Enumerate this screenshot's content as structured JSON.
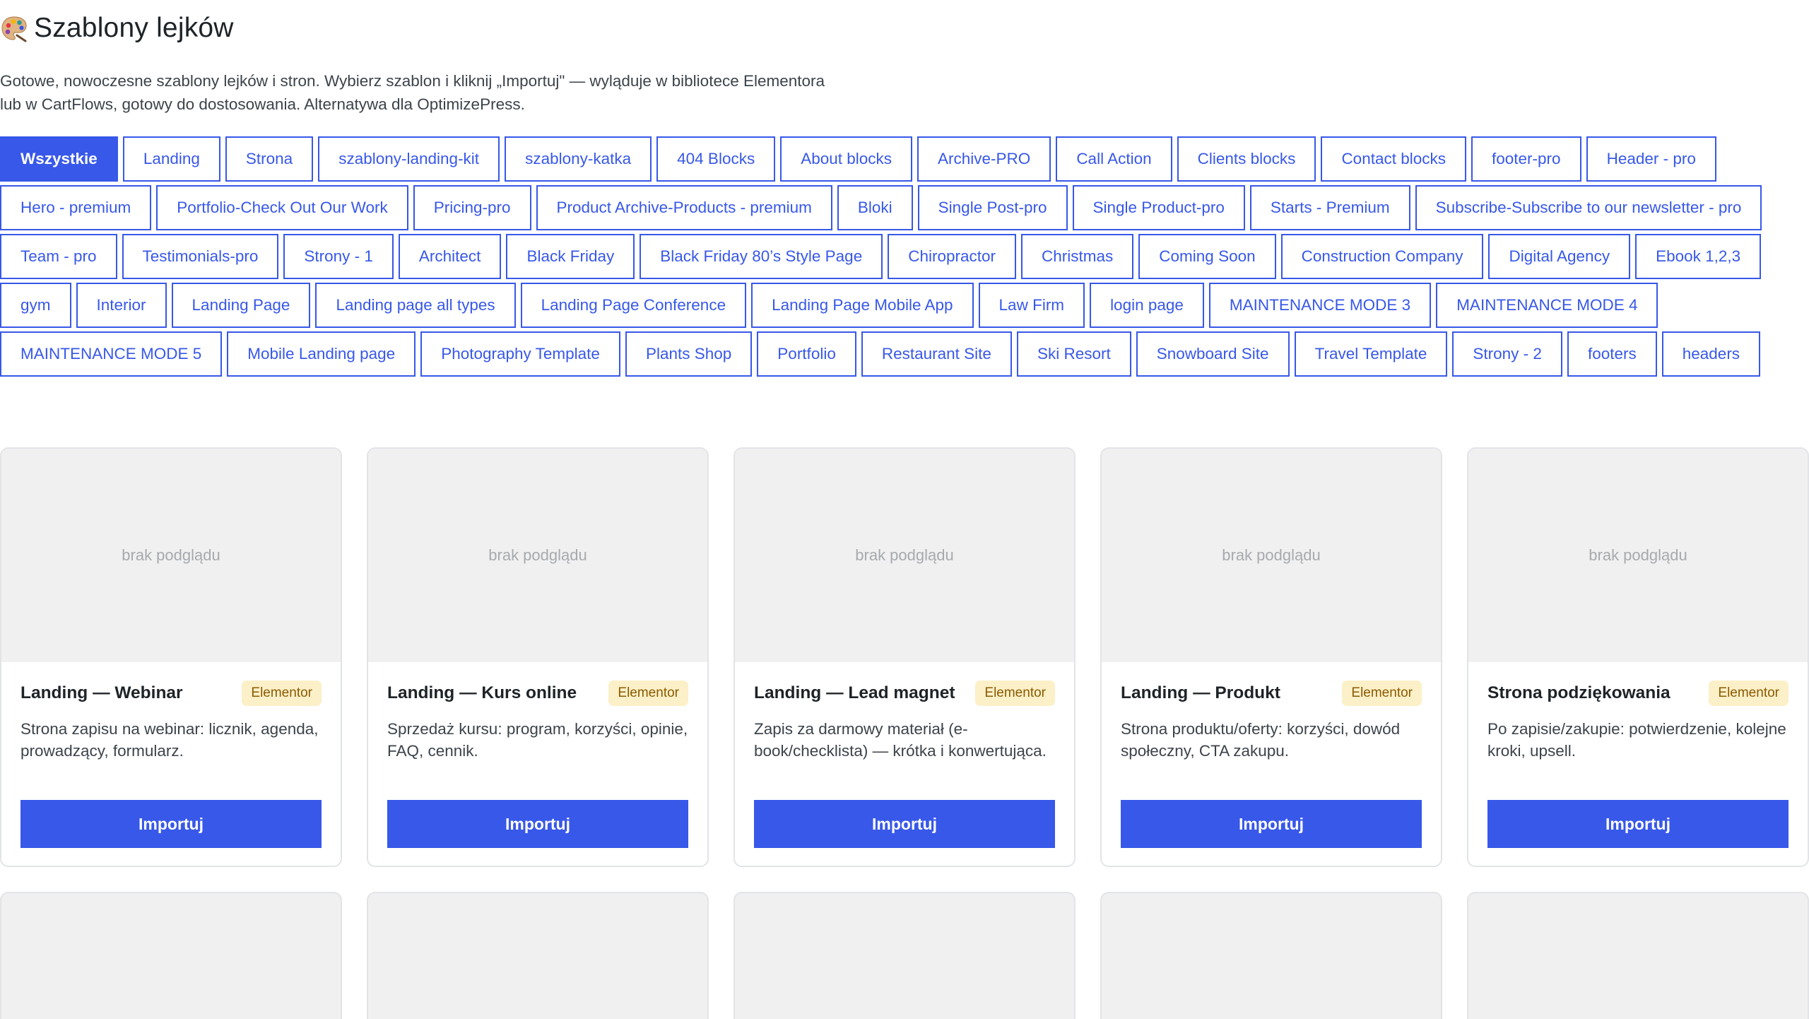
{
  "header": {
    "icon": "palette-icon",
    "title": "Szablony lejków",
    "description_line1": "Gotowe, nowoczesne szablony lejków i stron. Wybierz szablon i kliknij „Importuj\" — wyląduje w bibliotece Elementora",
    "description_line2": "lub w CartFlows, gotowy do dostosowania. Alternatywa dla OptimizePress."
  },
  "accent_color": "#3858e9",
  "active_filter": "Wszystkie",
  "filters": [
    "Wszystkie",
    "Landing",
    "Strona",
    "szablony-landing-kit",
    "szablony-katka",
    "404 Blocks",
    "About blocks",
    "Archive-PRO",
    "Call Action",
    "Clients blocks",
    "Contact blocks",
    "footer-pro",
    "Header - pro",
    "Hero - premium",
    "Portfolio-Check Out Our Work",
    "Pricing-pro",
    "Product Archive-Products - premium",
    "Bloki",
    "Single Post-pro",
    "Single Product-pro",
    "Starts - Premium",
    "Subscribe-Subscribe to our newsletter - pro",
    "Team - pro",
    "Testimonials-pro",
    "Strony - 1",
    "Architect",
    "Black Friday",
    "Black Friday 80’s Style Page",
    "Chiropractor",
    "Christmas",
    "Coming Soon",
    "Construction Company",
    "Digital Agency",
    "Ebook 1,2,3",
    "gym",
    "Interior",
    "Landing Page",
    "Landing page all types",
    "Landing Page Conference",
    "Landing Page Mobile App",
    "Law Firm",
    "login page",
    "MAINTENANCE MODE 3",
    "MAINTENANCE MODE 4",
    "MAINTENANCE MODE 5",
    "Mobile Landing page",
    "Photography Template",
    "Plants Shop",
    "Portfolio",
    "Restaurant Site",
    "Ski Resort",
    "Snowboard Site",
    "Travel Template",
    "Strony - 2",
    "footers",
    "headers"
  ],
  "cards": [
    {
      "preview": "brak podglądu",
      "title": "Landing — Webinar",
      "badge": "Elementor",
      "description": "Strona zapisu na webinar: licznik, agenda, prowadzący, formularz.",
      "button": "Importuj"
    },
    {
      "preview": "brak podglądu",
      "title": "Landing — Kurs online",
      "badge": "Elementor",
      "description": "Sprzedaż kursu: program, korzyści, opinie, FAQ, cennik.",
      "button": "Importuj"
    },
    {
      "preview": "brak podglądu",
      "title": "Landing — Lead magnet",
      "badge": "Elementor",
      "description": "Zapis za darmowy materiał (e-book/checklista) — krótka i konwertująca.",
      "button": "Importuj"
    },
    {
      "preview": "brak podglądu",
      "title": "Landing — Produkt",
      "badge": "Elementor",
      "description": "Strona produktu/oferty: korzyści, dowód społeczny, CTA zakupu.",
      "button": "Importuj"
    },
    {
      "preview": "brak podglądu",
      "title": "Strona podziękowania",
      "badge": "Elementor",
      "description": "Po zapisie/zakupie: potwierdzenie, kolejne kroki, upsell.",
      "button": "Importuj"
    }
  ],
  "more_cards_row_count": 5
}
